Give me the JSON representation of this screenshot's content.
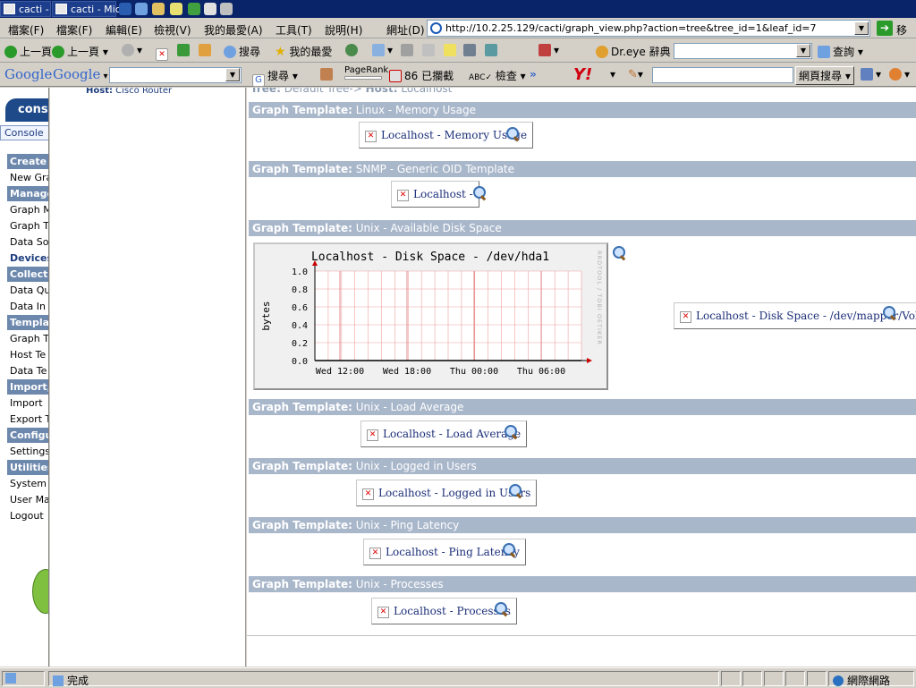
{
  "taskbar": {
    "buttons": [
      "cacti - I",
      "cacti - Micr"
    ]
  },
  "menubar": {
    "menu_left": "檔案(F)",
    "items": [
      "檔案(F)",
      "編輯(E)",
      "檢視(V)",
      "我的最愛(A)",
      "工具(T)",
      "說明(H)"
    ],
    "address_label": "網址(D)",
    "address_url": "http://10.2.25.129/cacti/graph_view.php?action=tree&tree_id=1&leaf_id=7",
    "go_label": "移至"
  },
  "toolbar": {
    "back_left": "上一頁",
    "back": "上一頁",
    "search": "搜尋",
    "favorites": "我的最愛",
    "dreye": "Dr.eye 辭典",
    "query": "查詢"
  },
  "google_bar": {
    "google_left": "Google",
    "google": "Google",
    "search": "搜尋",
    "pagerank": "PageRank",
    "blocked": "86 已攔截",
    "check": "檢查",
    "more": "»",
    "web_search": "網頁搜尋"
  },
  "sidebar": {
    "tab": "cons",
    "console": "Console",
    "items": [
      {
        "label": "Create",
        "header": true
      },
      {
        "label": "New Gra",
        "header": false
      },
      {
        "label": "Manage",
        "header": true
      },
      {
        "label": "Graph M",
        "header": false
      },
      {
        "label": "Graph T",
        "header": false
      },
      {
        "label": "Data So",
        "header": false
      },
      {
        "label": "Devices",
        "header": false,
        "active": true
      },
      {
        "label": "Collecti",
        "header": true
      },
      {
        "label": "Data Qu",
        "header": false
      },
      {
        "label": "Data In",
        "header": false
      },
      {
        "label": "Templat",
        "header": true
      },
      {
        "label": "Graph T",
        "header": false
      },
      {
        "label": "Host Te",
        "header": false
      },
      {
        "label": "Data Te",
        "header": false
      },
      {
        "label": "Import,",
        "header": true
      },
      {
        "label": "Import",
        "header": false
      },
      {
        "label": "Export T",
        "header": false
      },
      {
        "label": "Configu",
        "header": true
      },
      {
        "label": "Settings",
        "header": false
      },
      {
        "label": "Utilities",
        "header": true
      },
      {
        "label": "System",
        "header": false
      },
      {
        "label": "User Ma",
        "header": false
      },
      {
        "label": "Logout",
        "header": false
      }
    ]
  },
  "tree_panel": {
    "host_label": "Host:",
    "host_value": "Cisco Router"
  },
  "main": {
    "breadcrumb_tree": "Tree:",
    "breadcrumb_text": "Default Tree->",
    "breadcrumb_host": "Host:",
    "breadcrumb_host_value": "Localhost",
    "sections": [
      {
        "prefix": "Graph Template:",
        "name": "Linux - Memory Usage",
        "graphs": [
          "Localhost - Memory Usage"
        ]
      },
      {
        "prefix": "Graph Template:",
        "name": "SNMP - Generic OID Template",
        "graphs": [
          "Localhost -"
        ]
      },
      {
        "prefix": "Graph Template:",
        "name": "Unix - Available Disk Space",
        "graphs": [
          "Localhost - Disk Space - /dev/mapper/Vol"
        ]
      },
      {
        "prefix": "Graph Template:",
        "name": "Unix - Load Average",
        "graphs": [
          "Localhost - Load Average"
        ]
      },
      {
        "prefix": "Graph Template:",
        "name": "Unix - Logged in Users",
        "graphs": [
          "Localhost - Logged in Users"
        ]
      },
      {
        "prefix": "Graph Template:",
        "name": "Unix - Ping Latency",
        "graphs": [
          "Localhost - Ping Latency"
        ]
      },
      {
        "prefix": "Graph Template:",
        "name": "Unix - Processes",
        "graphs": [
          "Localhost - Processes"
        ]
      }
    ]
  },
  "chart_data": {
    "type": "line",
    "title": "Localhost - Disk Space - /dev/hda1",
    "ylabel": "bytes",
    "xlabel": "",
    "watermark": "RRDTOOL / TOBI OETIKER",
    "categories": [
      "Wed 12:00",
      "Wed 18:00",
      "Thu 00:00",
      "Thu 06:00"
    ],
    "yticks": [
      "1.0",
      "0.8",
      "0.6",
      "0.4",
      "0.2",
      "0.0"
    ],
    "ylim": [
      0,
      1
    ],
    "series": [
      {
        "values": [
          0,
          0,
          0,
          0
        ]
      }
    ],
    "grid": true,
    "colors": {
      "grid": "#f0a0a0",
      "axis": "#000000",
      "arrow": "#cc0000"
    }
  },
  "statusbar": {
    "text": "完成",
    "zone": "網際網路"
  }
}
